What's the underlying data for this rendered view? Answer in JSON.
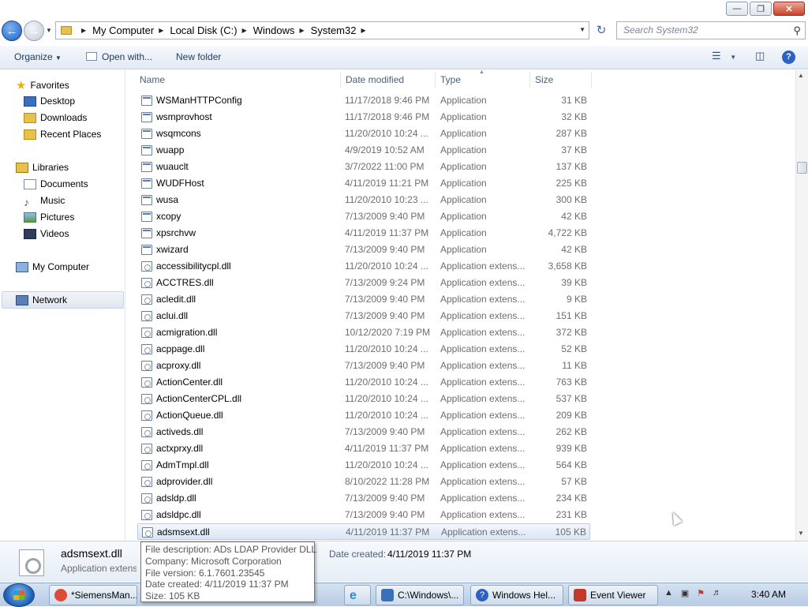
{
  "address": {
    "crumbs": [
      "My Computer",
      "Local Disk (C:)",
      "Windows",
      "System32"
    ],
    "search_placeholder": "Search System32"
  },
  "toolbar": {
    "organize": "Organize",
    "open_with": "Open with...",
    "new_folder": "New folder"
  },
  "nav": {
    "favorites": "Favorites",
    "desktop": "Desktop",
    "downloads": "Downloads",
    "recent": "Recent Places",
    "libraries": "Libraries",
    "documents": "Documents",
    "music": "Music",
    "pictures": "Pictures",
    "videos": "Videos",
    "computer": "My Computer",
    "network": "Network"
  },
  "columns": {
    "name": "Name",
    "date": "Date modified",
    "type": "Type",
    "size": "Size"
  },
  "files": [
    {
      "name": "WSManHTTPConfig",
      "date": "11/17/2018 9:46 PM",
      "type": "Application",
      "size": "31 KB",
      "kind": "app"
    },
    {
      "name": "wsmprovhost",
      "date": "11/17/2018 9:46 PM",
      "type": "Application",
      "size": "32 KB",
      "kind": "app"
    },
    {
      "name": "wsqmcons",
      "date": "11/20/2010 10:24 ...",
      "type": "Application",
      "size": "287 KB",
      "kind": "app"
    },
    {
      "name": "wuapp",
      "date": "4/9/2019 10:52 AM",
      "type": "Application",
      "size": "37 KB",
      "kind": "app"
    },
    {
      "name": "wuauclt",
      "date": "3/7/2022 11:00 PM",
      "type": "Application",
      "size": "137 KB",
      "kind": "app"
    },
    {
      "name": "WUDFHost",
      "date": "4/11/2019 11:21 PM",
      "type": "Application",
      "size": "225 KB",
      "kind": "app"
    },
    {
      "name": "wusa",
      "date": "11/20/2010 10:23 ...",
      "type": "Application",
      "size": "300 KB",
      "kind": "app"
    },
    {
      "name": "xcopy",
      "date": "7/13/2009 9:40 PM",
      "type": "Application",
      "size": "42 KB",
      "kind": "app"
    },
    {
      "name": "xpsrchvw",
      "date": "4/11/2019 11:37 PM",
      "type": "Application",
      "size": "4,722 KB",
      "kind": "app"
    },
    {
      "name": "xwizard",
      "date": "7/13/2009 9:40 PM",
      "type": "Application",
      "size": "42 KB",
      "kind": "app"
    },
    {
      "name": "accessibilitycpl.dll",
      "date": "11/20/2010 10:24 ...",
      "type": "Application extens...",
      "size": "3,658 KB",
      "kind": "dll"
    },
    {
      "name": "ACCTRES.dll",
      "date": "7/13/2009 9:24 PM",
      "type": "Application extens...",
      "size": "39 KB",
      "kind": "dll"
    },
    {
      "name": "acledit.dll",
      "date": "7/13/2009 9:40 PM",
      "type": "Application extens...",
      "size": "9 KB",
      "kind": "dll"
    },
    {
      "name": "aclui.dll",
      "date": "7/13/2009 9:40 PM",
      "type": "Application extens...",
      "size": "151 KB",
      "kind": "dll"
    },
    {
      "name": "acmigration.dll",
      "date": "10/12/2020 7:19 PM",
      "type": "Application extens...",
      "size": "372 KB",
      "kind": "dll"
    },
    {
      "name": "acppage.dll",
      "date": "11/20/2010 10:24 ...",
      "type": "Application extens...",
      "size": "52 KB",
      "kind": "dll"
    },
    {
      "name": "acproxy.dll",
      "date": "7/13/2009 9:40 PM",
      "type": "Application extens...",
      "size": "11 KB",
      "kind": "dll"
    },
    {
      "name": "ActionCenter.dll",
      "date": "11/20/2010 10:24 ...",
      "type": "Application extens...",
      "size": "763 KB",
      "kind": "dll"
    },
    {
      "name": "ActionCenterCPL.dll",
      "date": "11/20/2010 10:24 ...",
      "type": "Application extens...",
      "size": "537 KB",
      "kind": "dll"
    },
    {
      "name": "ActionQueue.dll",
      "date": "11/20/2010 10:24 ...",
      "type": "Application extens...",
      "size": "209 KB",
      "kind": "dll"
    },
    {
      "name": "activeds.dll",
      "date": "7/13/2009 9:40 PM",
      "type": "Application extens...",
      "size": "262 KB",
      "kind": "dll"
    },
    {
      "name": "actxprxy.dll",
      "date": "4/11/2019 11:37 PM",
      "type": "Application extens...",
      "size": "939 KB",
      "kind": "dll"
    },
    {
      "name": "AdmTmpl.dll",
      "date": "11/20/2010 10:24 ...",
      "type": "Application extens...",
      "size": "564 KB",
      "kind": "dll"
    },
    {
      "name": "adprovider.dll",
      "date": "8/10/2022 11:28 PM",
      "type": "Application extens...",
      "size": "57 KB",
      "kind": "dll"
    },
    {
      "name": "adsldp.dll",
      "date": "7/13/2009 9:40 PM",
      "type": "Application extens...",
      "size": "234 KB",
      "kind": "dll"
    },
    {
      "name": "adsldpc.dll",
      "date": "7/13/2009 9:40 PM",
      "type": "Application extens...",
      "size": "231 KB",
      "kind": "dll"
    },
    {
      "name": "adsmsext.dll",
      "date": "4/11/2019 11:37 PM",
      "type": "Application extens...",
      "size": "105 KB",
      "kind": "dll",
      "selected": true
    }
  ],
  "details": {
    "name": "adsmsext.dll",
    "type": "Application extension",
    "created_label": "Date created:",
    "created_value": "4/11/2019 11:37 PM"
  },
  "tooltip": {
    "desc": "File description: ADs LDAP Provider DLL",
    "company": "Company: Microsoft Corporation",
    "version": "File version: 6.1.7601.23545",
    "created": "Date created: 4/11/2019 11:37 PM",
    "size": "Size: 105 KB"
  },
  "taskbar": {
    "tasks": [
      {
        "label": "*SiemensMan...",
        "color": "#dd4b39"
      },
      {
        "label": "C:\\Windows\\...",
        "color": "#3b6fb6"
      },
      {
        "label": "Windows Hel...",
        "color": "#2d62c2"
      },
      {
        "label": "Event Viewer",
        "color": "#c0392b"
      }
    ],
    "clock": "3:40 AM"
  }
}
